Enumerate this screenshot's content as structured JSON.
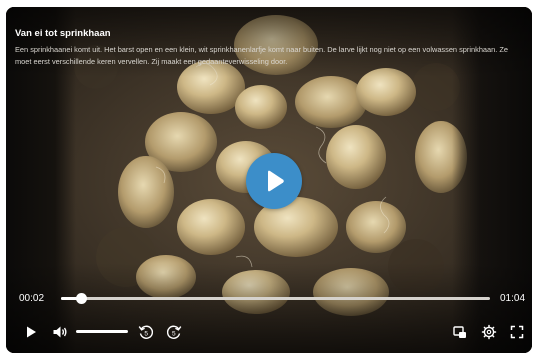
{
  "video": {
    "title": "Van ei tot sprinkhaan",
    "description": "Een sprinkhaanei komt uit. Het barst open en een klein, wit sprinkhanenlarfje komt naar buiten. De larve lijkt nog niet op een volwassen sprinkhaan. Ze moet eerst verschillende keren vervellen. Zij maakt een gedaanteverwisseling door.",
    "current_time": "00:02",
    "duration": "01:04",
    "progress_fraction": 0.047,
    "volume_fraction": 1.0
  },
  "controls": {
    "big_play_icon": "play-icon",
    "play_icon": "play-icon",
    "volume_icon": "volume-icon",
    "rewind_icon": "rewind-5-icon",
    "forward_icon": "forward-5-icon",
    "rewind_label": "5",
    "forward_label": "5",
    "audio_description_icon": "audio-description-icon",
    "settings_icon": "gear-icon",
    "fullscreen_icon": "fullscreen-icon"
  },
  "colors": {
    "accent": "#3c8ec9",
    "text": "#ffffff"
  }
}
